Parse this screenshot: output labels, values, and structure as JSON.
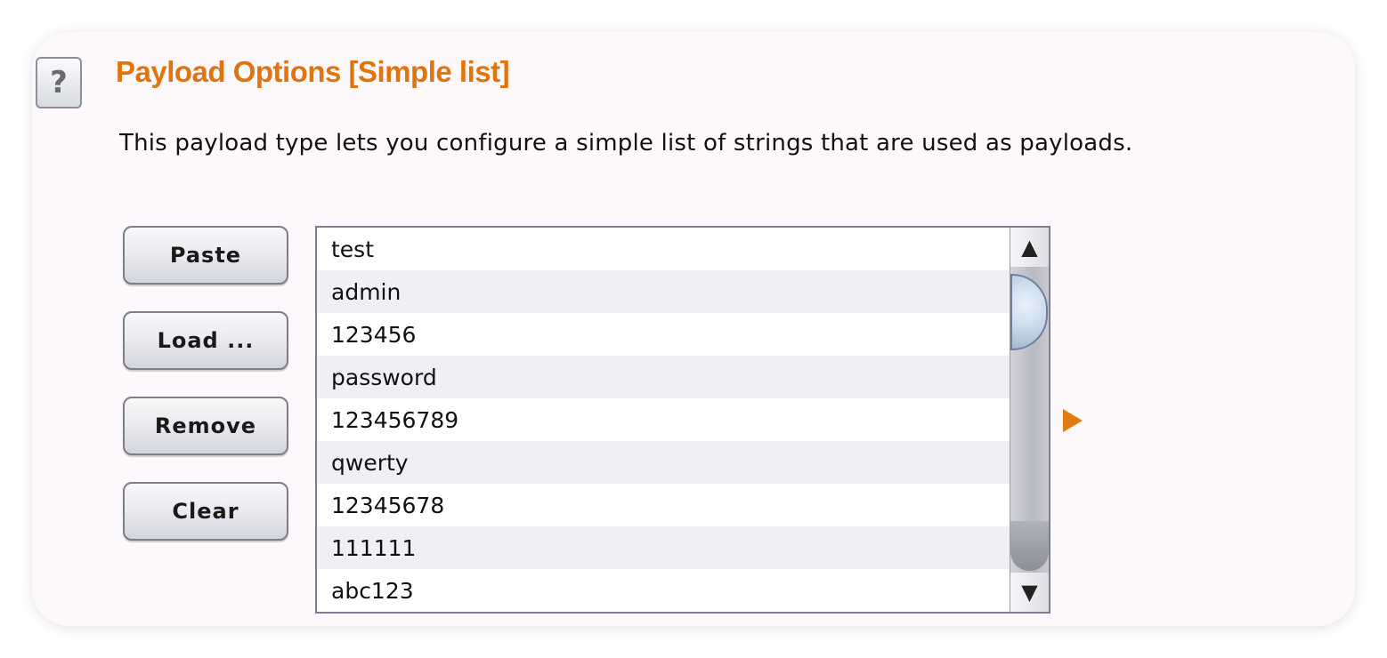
{
  "help_button": {
    "label": "?"
  },
  "header": {
    "title": "Payload Options [Simple list]"
  },
  "description": "This payload type lets you configure a simple list of strings that are used as payloads.",
  "buttons": {
    "paste": "Paste",
    "load": "Load ...",
    "remove": "Remove",
    "clear": "Clear"
  },
  "payload_list": {
    "items": [
      "test",
      "admin",
      "123456",
      "password",
      "123456789",
      "qwerty",
      "12345678",
      "111111",
      "abc123"
    ]
  },
  "scrollbar": {
    "up_glyph": "▲",
    "down_glyph": "▼"
  },
  "colors": {
    "title": "#e1740c",
    "expand_arrow": "#e27a12",
    "panel_background": "#fcf8fc"
  },
  "icons": {
    "help": "question-mark-icon",
    "expand": "triangle-right-icon"
  }
}
